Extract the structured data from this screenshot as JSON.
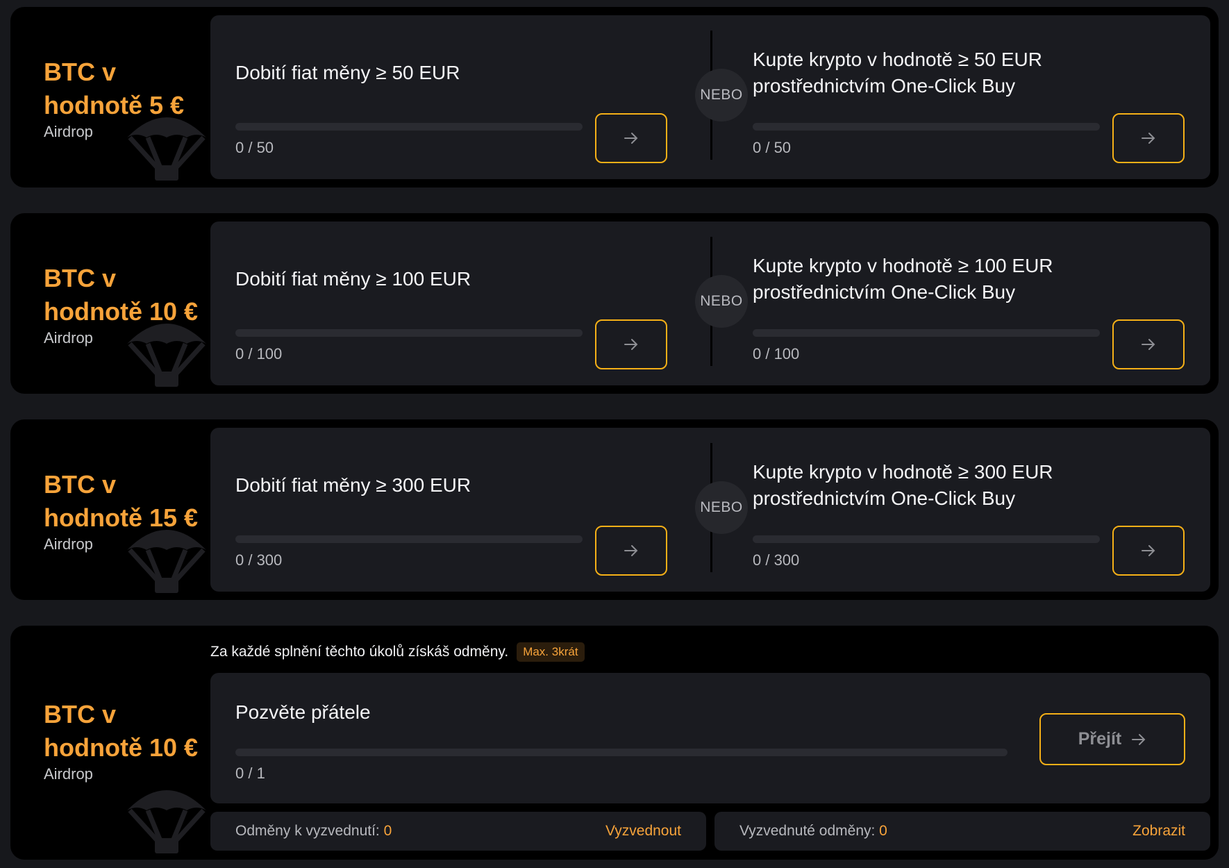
{
  "icons": {
    "arrow": "arrow-right-icon",
    "parachute": "parachute-icon"
  },
  "colors": {
    "accent": "#f7a33a",
    "button_border": "#f5b017",
    "card_bg": "#000000",
    "panel_bg": "#1a1b20"
  },
  "airdrops": [
    {
      "reward_line1": "BTC v",
      "reward_line2": "hodnotě 5 €",
      "reward_type": "Airdrop",
      "or_label": "NEBO",
      "left_task": {
        "title": "Dobití fiat měny ≥ 50 EUR",
        "progress_text": "0 / 50",
        "progress": 0
      },
      "right_task": {
        "title_line1": "Kupte krypto v hodnotě ≥ 50 EUR",
        "title_line2": "prostřednictvím One-Click Buy",
        "progress_text": "0 / 50",
        "progress": 0
      }
    },
    {
      "reward_line1": "BTC v",
      "reward_line2": "hodnotě 10 €",
      "reward_type": "Airdrop",
      "or_label": "NEBO",
      "left_task": {
        "title": "Dobití fiat měny ≥ 100 EUR",
        "progress_text": "0 / 100",
        "progress": 0
      },
      "right_task": {
        "title_line1": "Kupte krypto v hodnotě ≥ 100 EUR",
        "title_line2": "prostřednictvím One-Click Buy",
        "progress_text": "0 / 100",
        "progress": 0
      }
    },
    {
      "reward_line1": "BTC v",
      "reward_line2": "hodnotě 15 €",
      "reward_type": "Airdrop",
      "or_label": "NEBO",
      "left_task": {
        "title": "Dobití fiat měny ≥ 300 EUR",
        "progress_text": "0 / 300",
        "progress": 0
      },
      "right_task": {
        "title_line1": "Kupte krypto v hodnotě ≥ 300 EUR",
        "title_line2": "prostřednictvím One-Click Buy",
        "progress_text": "0 / 300",
        "progress": 0
      }
    }
  ],
  "referral": {
    "reward_line1": "BTC v",
    "reward_line2": "hodnotě 10 €",
    "reward_type": "Airdrop",
    "note": "Za každé splnění těchto úkolů získáš odměny.",
    "badge": "Max. 3krát",
    "task_title": "Pozvěte přátele",
    "progress_text": "0 / 1",
    "progress": 0,
    "button_label": "Přejít",
    "claimable_label": "Odměny k vyzvednutí: ",
    "claimable_value": "0",
    "claim_link": "Vyzvednout",
    "claimed_label": "Vyzvednuté odměny: ",
    "claimed_value": "0",
    "view_link": "Zobrazit"
  }
}
